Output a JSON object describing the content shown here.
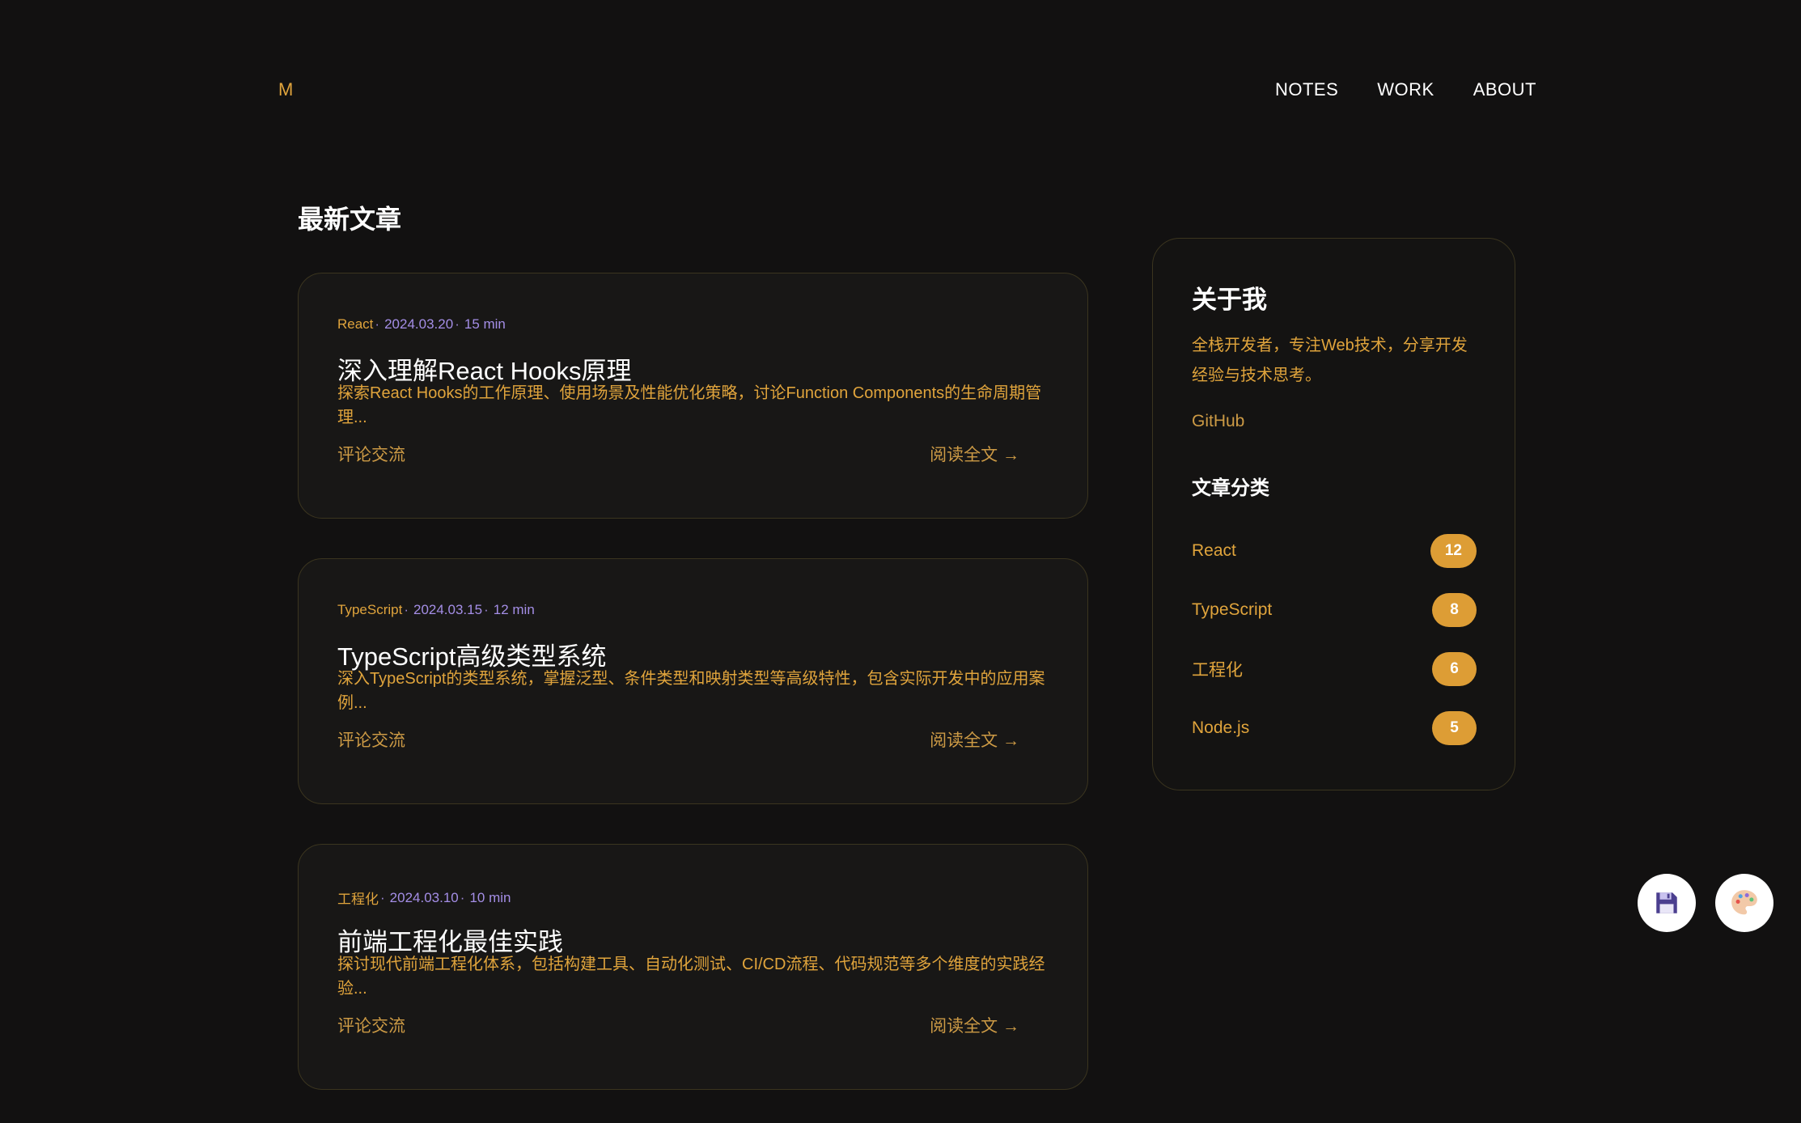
{
  "header": {
    "logo": "M",
    "nav": [
      "NOTES",
      "WORK",
      "ABOUT"
    ]
  },
  "main": {
    "section_title": "最新文章",
    "posts": [
      {
        "category": "React",
        "date": "2024.03.20",
        "duration": "15 min",
        "title": "深入理解React Hooks原理",
        "excerpt": "探索React Hooks的工作原理、使用场景及性能优化策略，讨论Function Components的生命周期管理...",
        "comments": "评论交流",
        "read_more": "阅读全文 →"
      },
      {
        "category": "TypeScript",
        "date": "2024.03.15",
        "duration": "12 min",
        "title": "TypeScript高级类型系统",
        "excerpt": "深入TypeScript的类型系统，掌握泛型、条件类型和映射类型等高级特性，包含实际开发中的应用案例...",
        "comments": "评论交流",
        "read_more": "阅读全文 →"
      },
      {
        "category": "工程化",
        "date": "2024.03.10",
        "duration": "10 min",
        "title": "前端工程化最佳实践",
        "excerpt": "探讨现代前端工程化体系，包括构建工具、自动化测试、CI/CD流程、代码规范等多个维度的实践经验...",
        "comments": "评论交流",
        "read_more": "阅读全文 →"
      }
    ]
  },
  "sidebar": {
    "about_title": "关于我",
    "about_desc": "全栈开发者，专注Web技术，分享开发经验与技术思考。",
    "github": "GitHub",
    "categories_title": "文章分类",
    "categories": [
      {
        "name": "React",
        "count": "12"
      },
      {
        "name": "TypeScript",
        "count": "8"
      },
      {
        "name": "工程化",
        "count": "6"
      },
      {
        "name": "Node.js",
        "count": "5"
      }
    ]
  },
  "floating_buttons": {
    "save_icon": "floppy-disk-icon",
    "theme_icon": "palette-icon"
  },
  "colors": {
    "background": "#121111",
    "accent": "#e0a43c",
    "meta_purple": "#a48ee6",
    "card_border": "#3b351f",
    "badge": "#dd9d35"
  }
}
